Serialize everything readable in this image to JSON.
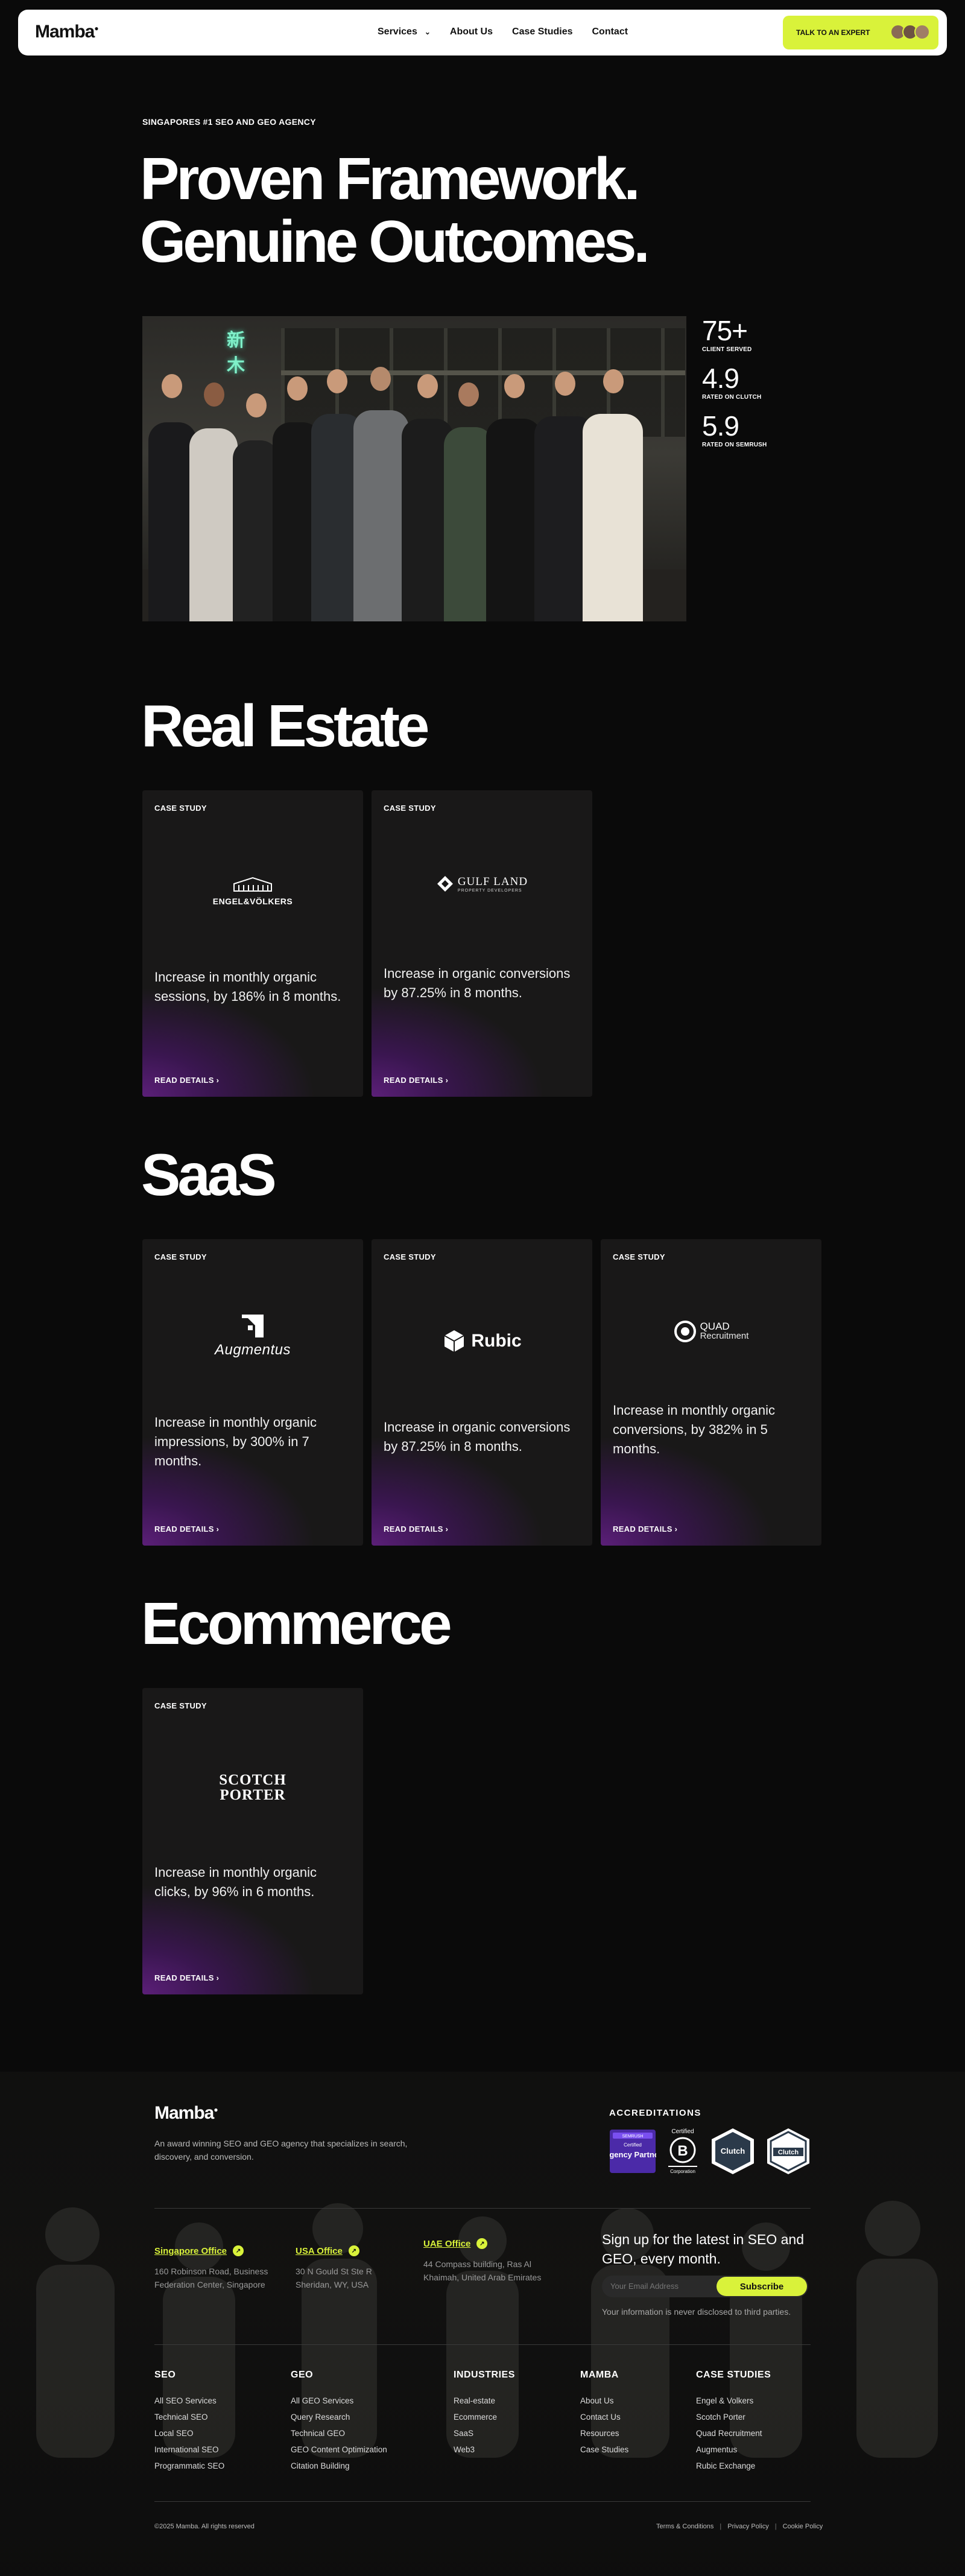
{
  "nav": {
    "logo": "Mamba",
    "links": [
      "Services",
      "About Us",
      "Case Studies",
      "Contact"
    ],
    "cta": "TALK TO AN EXPERT"
  },
  "hero": {
    "eyebrow": "SINGAPORES #1 SEO AND GEO AGENCY",
    "title": "Proven Framework. Genuine Outcomes.",
    "neon_sign": "新木",
    "stats": [
      {
        "value": "75+",
        "label": "CLIENT SERVED"
      },
      {
        "value": "4.9",
        "label": "RATED ON CLUTCH"
      },
      {
        "value": "5.9",
        "label": "RATED ON SEMRUSH"
      }
    ]
  },
  "sections": [
    {
      "title": "Real Estate",
      "cards": [
        {
          "eyebrow": "CASE STUDY",
          "logo": "ENGEL&VÖLKERS",
          "text": "Increase in monthly organic sessions, by 186% in 8 months.",
          "cta": "READ DETAILS"
        },
        {
          "eyebrow": "CASE STUDY",
          "logo": "GULF LAND",
          "logo_sub": "PROPERTY DEVELOPERS",
          "text": "Increase in organic conversions by 87.25% in 8 months.",
          "cta": "READ DETAILS"
        }
      ]
    },
    {
      "title": "SaaS",
      "cards": [
        {
          "eyebrow": "CASE STUDY",
          "logo": "Augmentus",
          "text": "Increase in monthly organic impressions, by 300% in 7 months.",
          "cta": "READ DETAILS"
        },
        {
          "eyebrow": "CASE STUDY",
          "logo": "Rubic",
          "text": "Increase in organic conversions by 87.25% in 8 months.",
          "cta": "READ DETAILS"
        },
        {
          "eyebrow": "CASE STUDY",
          "logo": "QUAD",
          "logo_sub": "Recruitment",
          "text": "Increase in monthly organic conversions, by 382% in 5 months.",
          "cta": "READ DETAILS"
        }
      ]
    },
    {
      "title": "Ecommerce",
      "cards": [
        {
          "eyebrow": "CASE STUDY",
          "logo": "SCOTCH PORTER",
          "text": "Increase in monthly organic clicks, by 96% in 6 months.",
          "cta": "READ DETAILS"
        }
      ]
    }
  ],
  "footer": {
    "logo": "Mamba",
    "description": "An award winning SEO and GEO agency that specializes in search, discovery, and conversion.",
    "accreditations_title": "ACCREDITATIONS",
    "badges": {
      "semrush": {
        "top": "SEMRUSH",
        "mid": "Certified",
        "big": "Agency Partner"
      },
      "bcorp": {
        "top": "Certified",
        "mid": "B",
        "bottom": "Corporation"
      },
      "clutch1": "Clutch",
      "clutch2": "Clutch"
    },
    "offices": [
      {
        "name": "Singapore Office",
        "address": "160 Robinson Road, Business Federation Center, Singapore"
      },
      {
        "name": "USA Office",
        "address": "30 N Gould St Ste R Sheridan, WY, USA"
      },
      {
        "name": "UAE Office",
        "address": "44 Compass building, Ras Al Khaimah, United Arab Emirates"
      }
    ],
    "newsletter": {
      "title": "Sign up for the latest in SEO and GEO, every month.",
      "placeholder": "Your Email Address",
      "button": "Subscribe",
      "note": "Your information is never disclosed to third parties."
    },
    "columns": [
      {
        "title": "SEO",
        "items": [
          "All SEO Services",
          "Technical SEO",
          "Local SEO",
          "International SEO",
          "Programmatic SEO"
        ]
      },
      {
        "title": "GEO",
        "items": [
          "All GEO Services",
          "Query Research",
          "Technical GEO",
          "GEO Content Optimization",
          "Citation Building"
        ]
      },
      {
        "title": "INDUSTRIES",
        "items": [
          "Real-estate",
          "Ecommerce",
          "SaaS",
          "Web3"
        ]
      },
      {
        "title": "MAMBA",
        "items": [
          "About Us",
          "Contact Us",
          "Resources",
          "Case Studies"
        ]
      },
      {
        "title": "CASE STUDIES",
        "items": [
          "Engel & Volkers",
          "Scotch Porter",
          "Quad Recruitment",
          "Augmentus",
          "Rubic Exchange"
        ]
      }
    ],
    "copyright": "©2025 Mamba. All rights reserved",
    "legal": [
      "Terms & Conditions",
      "Privacy Policy",
      "Cookie Policy"
    ]
  },
  "colors": {
    "accent": "#d9f23a",
    "background": "#0a0a0a",
    "card_glow": "#5b1f78"
  }
}
